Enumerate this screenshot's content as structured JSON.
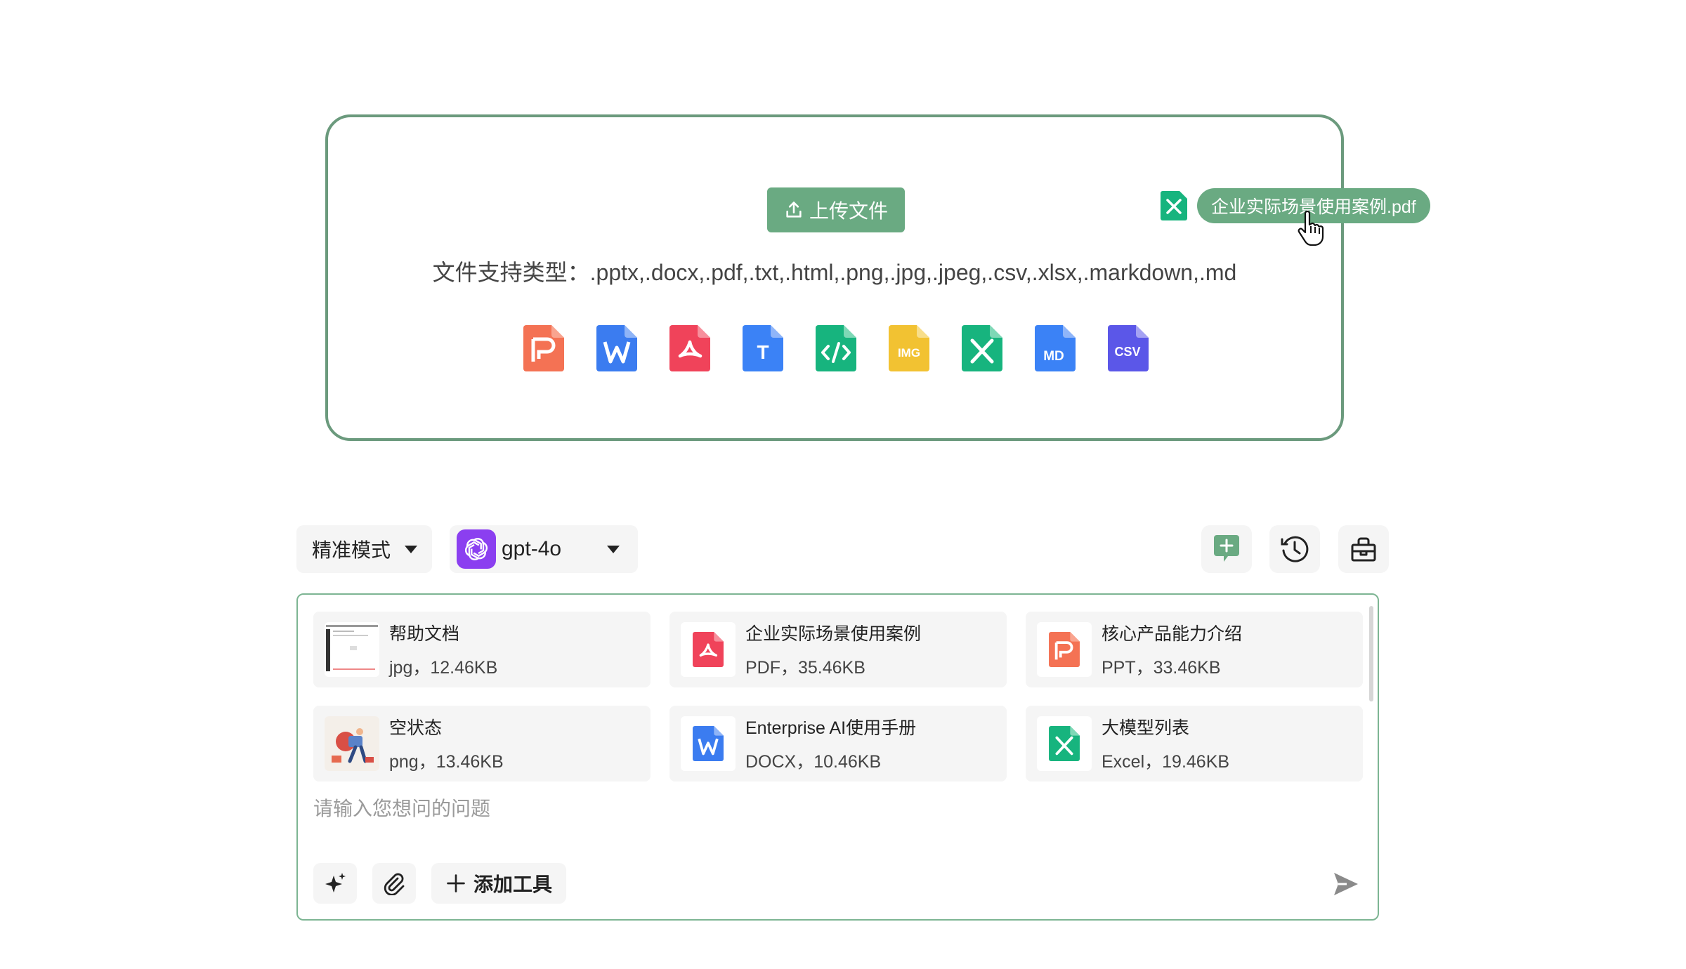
{
  "upload": {
    "button_label": "上传文件",
    "support_text": "文件支持类型：.pptx,.docx,.pdf,.txt,.html,.png,.jpg,.jpeg,.csv,.xlsx,.markdown,.md",
    "type_icons": [
      "ppt-file-icon",
      "word-file-icon",
      "pdf-file-icon",
      "txt-file-icon",
      "html-file-icon",
      "img-file-icon",
      "excel-file-icon",
      "md-file-icon",
      "csv-file-icon"
    ],
    "icon_labels": {
      "txt": "T",
      "img": "IMG",
      "md": "MD",
      "csv": "CSV"
    },
    "dragging_file": "企业实际场景使用案例.pdf"
  },
  "toolbar": {
    "mode": "精准模式",
    "model": "gpt-4o"
  },
  "chat": {
    "files": [
      {
        "name": "帮助文档",
        "meta": "jpg，12.46KB",
        "kind": "jpg"
      },
      {
        "name": "企业实际场景使用案例",
        "meta": "PDF，35.46KB",
        "kind": "pdf"
      },
      {
        "name": "核心产品能力介绍",
        "meta": "PPT，33.46KB",
        "kind": "ppt"
      },
      {
        "name": "空状态",
        "meta": "png，13.46KB",
        "kind": "png"
      },
      {
        "name": "Enterprise AI使用手册",
        "meta": "DOCX，10.46KB",
        "kind": "docx"
      },
      {
        "name": "大模型列表",
        "meta": "Excel，19.46KB",
        "kind": "excel"
      }
    ],
    "input_placeholder": "请输入您想问的问题",
    "add_tool_label": "添加工具"
  },
  "colors": {
    "accent": "#6aaa82",
    "panel_border": "#6b9a7d",
    "ppt": "#f47254",
    "word": "#3b7cf0",
    "pdf": "#f0435a",
    "txt": "#3b82f6",
    "html": "#17b47e",
    "img": "#f2c232",
    "excel": "#17b47e",
    "md": "#3b82f6",
    "csv": "#5b57e8",
    "model_logo": "#8b3ff0"
  }
}
